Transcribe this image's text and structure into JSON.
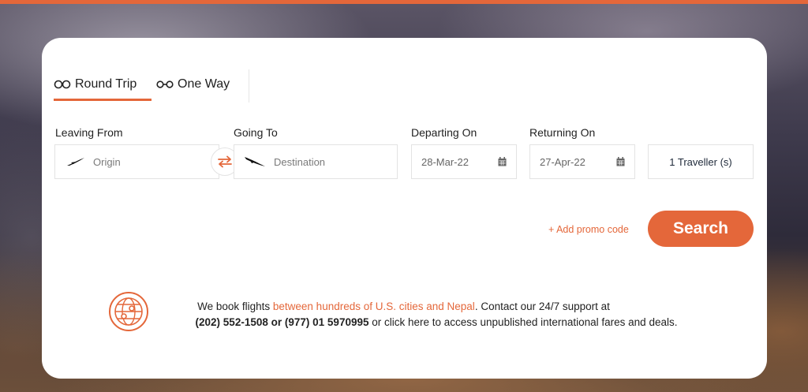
{
  "tabs": [
    {
      "label": "Round Trip",
      "icon": "round-trip-icon",
      "active": true
    },
    {
      "label": "One Way",
      "icon": "one-way-icon",
      "active": false
    }
  ],
  "form": {
    "leaving_from": {
      "label": "Leaving From",
      "placeholder": "Origin"
    },
    "going_to": {
      "label": "Going To",
      "placeholder": "Destination"
    },
    "departing_on": {
      "label": "Departing On",
      "value": "28-Mar-22"
    },
    "returning_on": {
      "label": "Returning On",
      "value": "27-Apr-22"
    },
    "travellers": {
      "value": "1 Traveller (s)"
    }
  },
  "actions": {
    "promo_label": "+ Add promo code",
    "search_label": "Search"
  },
  "info": {
    "line1_pre": "We book flights ",
    "line1_link": "between hundreds of U.S. cities and Nepal",
    "line1_post": ". Contact our 24/7 support at",
    "phone1": "(202) 552-1508",
    "or_word": "or",
    "phone2": "(977) 01 5970995",
    "line2_post": " or click here to access unpublished international fares and deals."
  },
  "colors": {
    "accent": "#e4673a",
    "card": "#ffffff",
    "text": "#222222"
  }
}
